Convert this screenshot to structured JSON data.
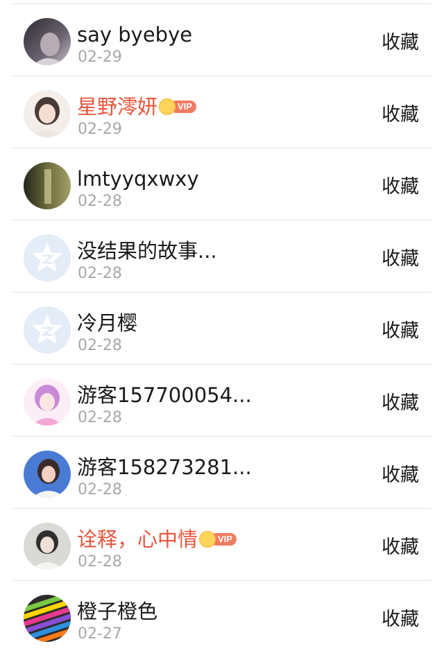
{
  "items": [
    {
      "name": "say byebye",
      "date": "02-29",
      "vip": false,
      "action": "收藏",
      "avatar": "photo"
    },
    {
      "name": "星野澪妍",
      "date": "02-29",
      "vip": true,
      "vip_label": "VIP",
      "action": "收藏",
      "avatar": "photo"
    },
    {
      "name": "lmtyyqxwxy",
      "date": "02-28",
      "vip": false,
      "action": "收藏",
      "avatar": "photo"
    },
    {
      "name": "没结果的故事...",
      "date": "02-28",
      "vip": false,
      "action": "收藏",
      "avatar": "default-qzone-icon"
    },
    {
      "name": "冷月樱",
      "date": "02-28",
      "vip": false,
      "action": "收藏",
      "avatar": "default-qzone-icon"
    },
    {
      "name": "游客157700054...",
      "date": "02-28",
      "vip": false,
      "action": "收藏",
      "avatar": "photo"
    },
    {
      "name": "游客158273281...",
      "date": "02-28",
      "vip": false,
      "action": "收藏",
      "avatar": "photo"
    },
    {
      "name": "诠释，心中情",
      "date": "02-28",
      "vip": true,
      "vip_label": "VIP",
      "action": "收藏",
      "avatar": "photo"
    },
    {
      "name": "橙子橙色",
      "date": "02-27",
      "vip": false,
      "action": "收藏",
      "avatar": "photo"
    }
  ],
  "colors": {
    "vip_name": "#e8553a",
    "text": "#1a1a1a",
    "date": "#a7a7a7",
    "divider": "#e3e3e3"
  }
}
